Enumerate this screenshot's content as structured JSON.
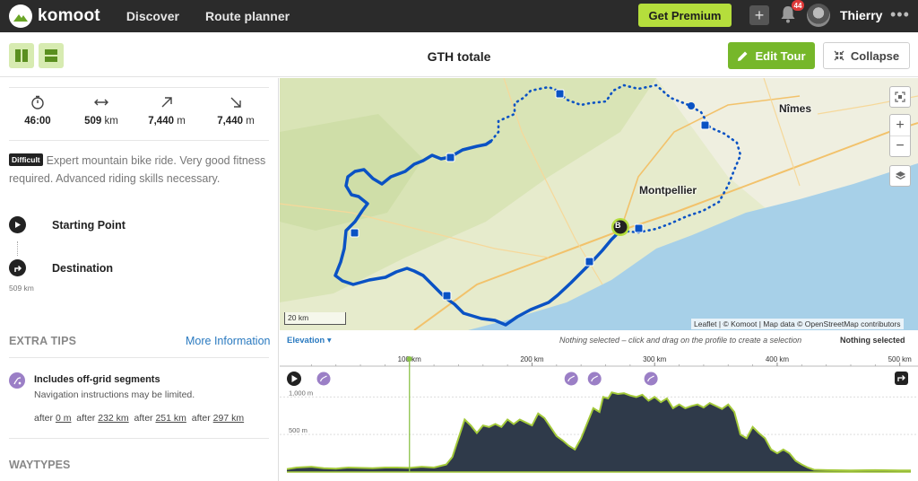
{
  "topbar": {
    "logo_text": "komoot",
    "nav": [
      "Discover",
      "Route planner"
    ],
    "premium_label": "Get Premium",
    "notification_count": "44",
    "username": "Thierry"
  },
  "header": {
    "title": "GTH totale",
    "edit_label": "Edit Tour",
    "collapse_label": "Collapse"
  },
  "stats": [
    {
      "icon": "stopwatch-icon",
      "value": "46:00",
      "unit": ""
    },
    {
      "icon": "horizontal-arrows-icon",
      "value": "509",
      "unit": "km"
    },
    {
      "icon": "arrow-up-right-icon",
      "value": "7,440",
      "unit": "m"
    },
    {
      "icon": "arrow-down-right-icon",
      "value": "7,440",
      "unit": "m"
    }
  ],
  "difficulty": {
    "badge": "Difficult",
    "text": "Expert mountain bike ride. Very good fitness required. Advanced riding skills necessary."
  },
  "waypoints": {
    "start_label": "Starting Point",
    "destination_label": "Destination",
    "distance": "509 km"
  },
  "extra_tips": {
    "heading": "EXTRA TIPS",
    "more_info": "More Information",
    "title": "Includes off-grid segments",
    "subtitle": "Navigation instructions may be limited.",
    "after_items": [
      {
        "prefix": "after",
        "value": "0 m"
      },
      {
        "prefix": "after",
        "value": "232 km"
      },
      {
        "prefix": "after",
        "value": "251 km"
      },
      {
        "prefix": "after",
        "value": "297 km"
      }
    ]
  },
  "waytypes_heading": "WAYTYPES",
  "map": {
    "cities": [
      "Nîmes",
      "Montpellier"
    ],
    "marker_label": "B",
    "scale_label": "20 km",
    "attribution": "Leaflet | © Komoot | Map data © OpenStreetMap contributors",
    "route_color": "#0a52c4",
    "sea_color": "#a7d0e8"
  },
  "elevation": {
    "toggle_label": "Elevation",
    "hint": "Nothing selected – click and drag on the profile to create a selection",
    "selection": "Nothing selected",
    "x_ticks": [
      "100 km",
      "200 km",
      "300 km",
      "400 km",
      "500 km"
    ],
    "y_ticks": [
      "1,000 m",
      "500 m"
    ],
    "max_km": 509,
    "max_m": 1100,
    "cursor_km": 100,
    "profile": [
      [
        0,
        40
      ],
      [
        8,
        60
      ],
      [
        20,
        70
      ],
      [
        30,
        50
      ],
      [
        40,
        45
      ],
      [
        50,
        60
      ],
      [
        60,
        55
      ],
      [
        70,
        50
      ],
      [
        80,
        60
      ],
      [
        90,
        60
      ],
      [
        100,
        55
      ],
      [
        110,
        70
      ],
      [
        120,
        60
      ],
      [
        130,
        100
      ],
      [
        135,
        200
      ],
      [
        140,
        450
      ],
      [
        145,
        700
      ],
      [
        150,
        620
      ],
      [
        155,
        520
      ],
      [
        160,
        620
      ],
      [
        165,
        600
      ],
      [
        170,
        640
      ],
      [
        175,
        600
      ],
      [
        180,
        700
      ],
      [
        185,
        640
      ],
      [
        190,
        700
      ],
      [
        195,
        660
      ],
      [
        200,
        620
      ],
      [
        205,
        780
      ],
      [
        210,
        720
      ],
      [
        215,
        600
      ],
      [
        220,
        480
      ],
      [
        225,
        420
      ],
      [
        230,
        350
      ],
      [
        235,
        300
      ],
      [
        240,
        450
      ],
      [
        245,
        650
      ],
      [
        250,
        850
      ],
      [
        255,
        800
      ],
      [
        258,
        1000
      ],
      [
        262,
        980
      ],
      [
        265,
        1060
      ],
      [
        270,
        1040
      ],
      [
        275,
        1050
      ],
      [
        280,
        1020
      ],
      [
        285,
        1000
      ],
      [
        290,
        1030
      ],
      [
        295,
        950
      ],
      [
        300,
        1000
      ],
      [
        305,
        930
      ],
      [
        310,
        980
      ],
      [
        315,
        850
      ],
      [
        320,
        900
      ],
      [
        325,
        850
      ],
      [
        330,
        880
      ],
      [
        335,
        900
      ],
      [
        340,
        860
      ],
      [
        345,
        920
      ],
      [
        350,
        880
      ],
      [
        355,
        840
      ],
      [
        360,
        900
      ],
      [
        365,
        800
      ],
      [
        370,
        500
      ],
      [
        375,
        450
      ],
      [
        380,
        600
      ],
      [
        385,
        520
      ],
      [
        390,
        450
      ],
      [
        395,
        300
      ],
      [
        400,
        250
      ],
      [
        405,
        300
      ],
      [
        410,
        250
      ],
      [
        415,
        150
      ],
      [
        420,
        100
      ],
      [
        425,
        60
      ],
      [
        430,
        30
      ],
      [
        440,
        25
      ],
      [
        460,
        20
      ],
      [
        480,
        25
      ],
      [
        500,
        22
      ],
      [
        509,
        20
      ]
    ],
    "offgrid_km": [
      0,
      232,
      251,
      297
    ]
  }
}
